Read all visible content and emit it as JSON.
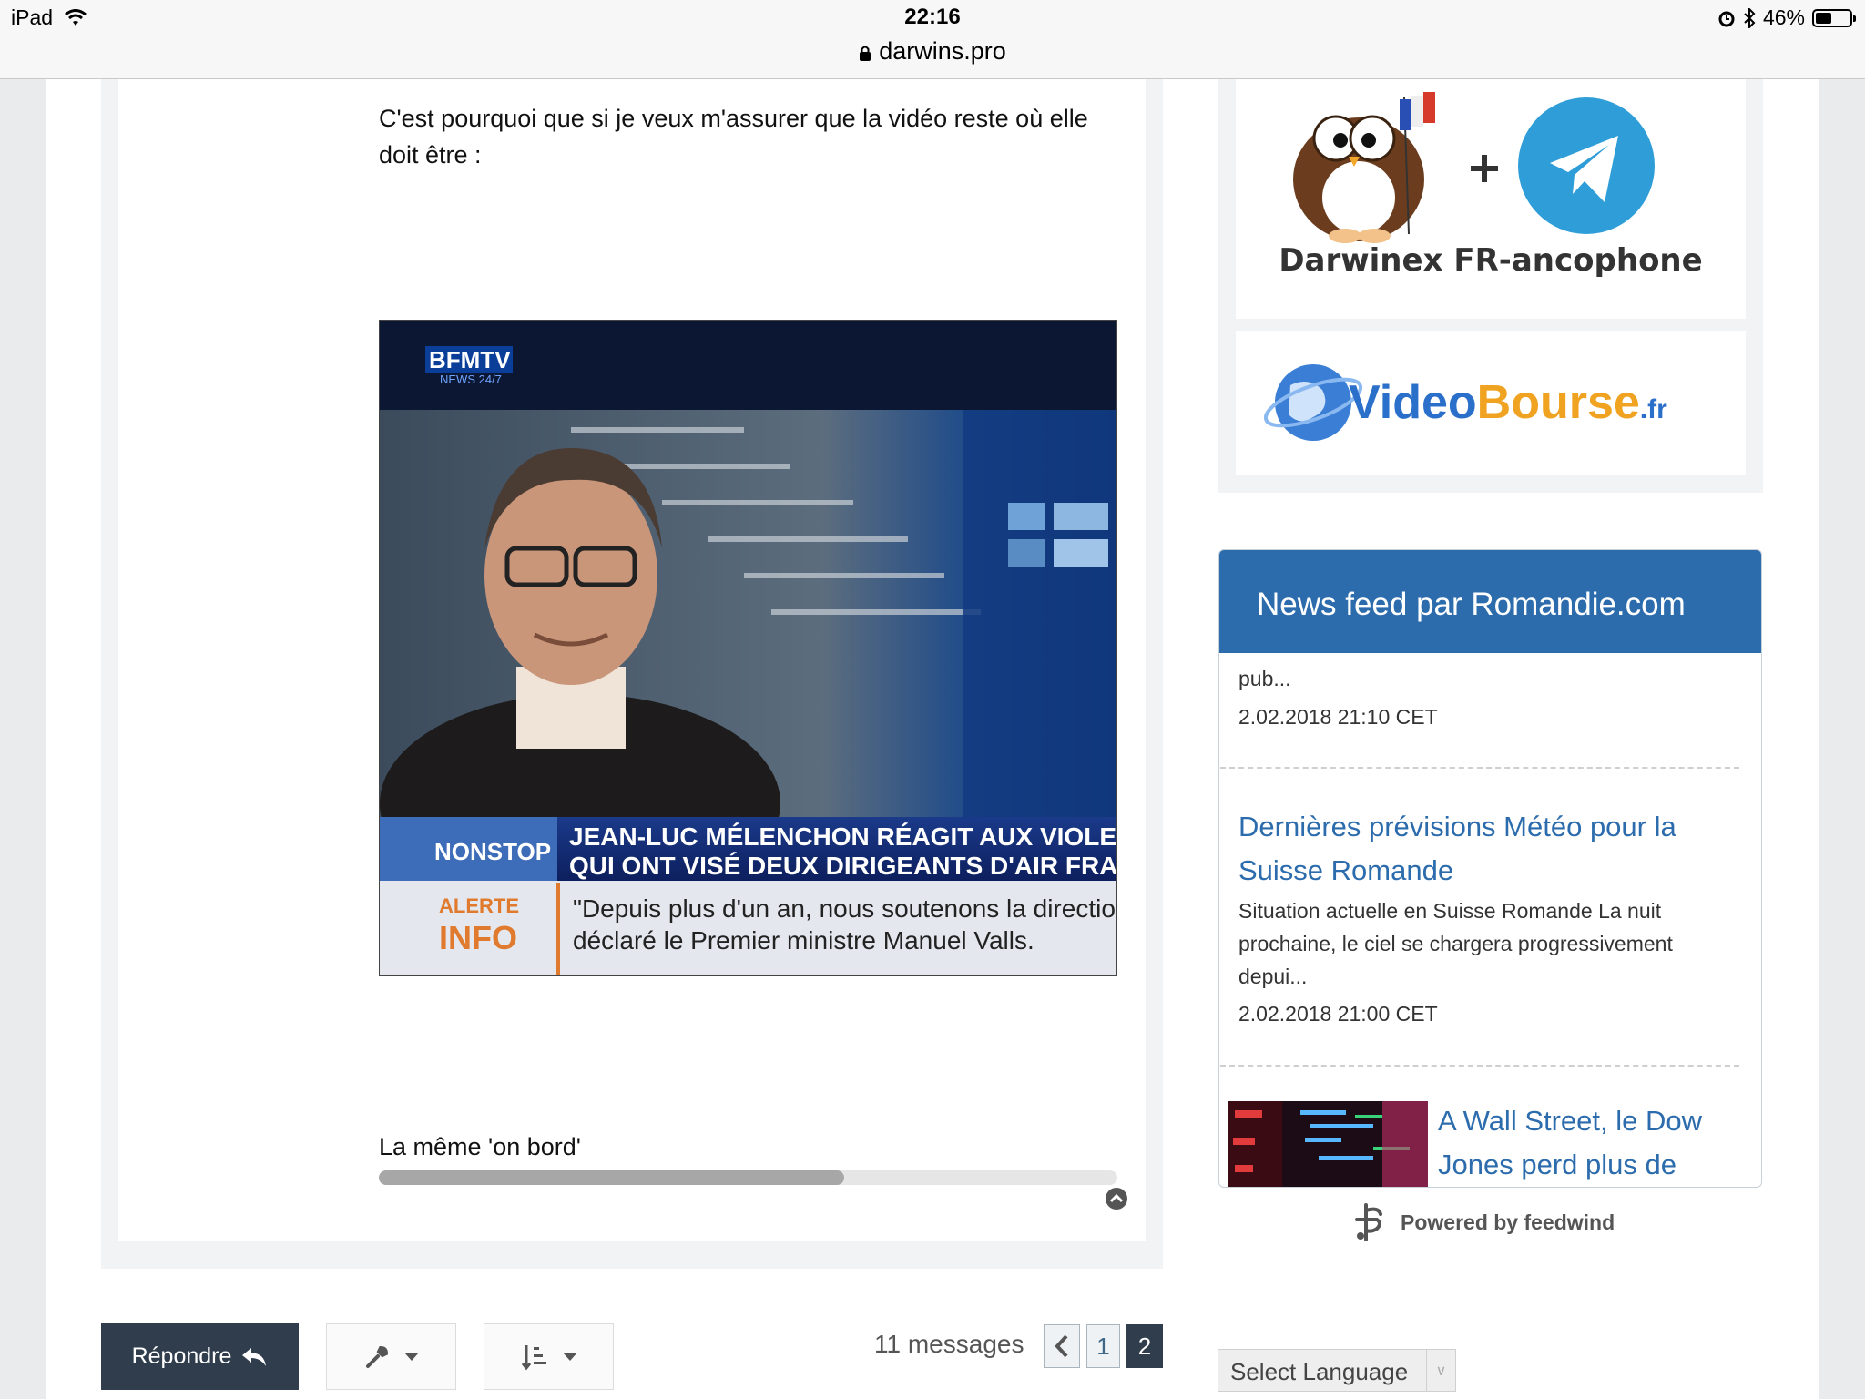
{
  "status_bar": {
    "device": "iPad",
    "time": "22:16",
    "url": "darwins.pro",
    "battery_text": "46%",
    "battery_level": 0.46
  },
  "post": {
    "text": "C'est pourquoi que si je veux m'assurer que la vidéo reste où elle doit être :",
    "video": {
      "channel_logo": "BFMTV",
      "channel_sub": "NEWS 24/7",
      "ticker_tag": "NONSTOP",
      "headline_line1": "JEAN-LUC MÉLENCHON RÉAGIT AUX VIOLE",
      "headline_line2": "QUI ONT VISÉ DEUX DIRIGEANTS D'AIR FRA",
      "alert_tag_1": "ALERTE",
      "alert_tag_2": "INFO",
      "quote_line1": "\"Depuis plus d'un an, nous soutenons la direction",
      "quote_line2": "déclaré le Premier ministre Manuel Valls."
    },
    "caption": "La même 'on bord'",
    "scroll_position": 0.63
  },
  "toolbar": {
    "reply_label": "Répondre",
    "message_count": "11 messages",
    "pages": [
      "1",
      "2"
    ],
    "current_page": "2"
  },
  "sidebar": {
    "telegram_banner_text": "Darwinex FR-ancophone",
    "videobourse_text_1": "Video",
    "videobourse_text_2": "Bourse",
    "videobourse_text_3": ".fr",
    "news_widget": {
      "title": "News feed par Romandie.com",
      "items": [
        {
          "snippet": "pub...",
          "date": "2.02.2018 21:10 CET"
        },
        {
          "title_line1": "Dernières prévisions Météo pour la",
          "title_line2": "Suisse Romande",
          "snippet_line1": "Situation actuelle en Suisse Romande La nuit",
          "snippet_line2": "prochaine, le ciel se chargera progressivement",
          "snippet_line3": "depui...",
          "date": "2.02.2018 21:00 CET"
        },
        {
          "title_line1": "A Wall Street, le Dow",
          "title_line2": "Jones perd plus de"
        }
      ],
      "powered_by": "Powered by feedwind"
    },
    "language_select": "Select Language"
  },
  "colors": {
    "accent": "#2c6cad",
    "dark_button": "#2f3d4c"
  }
}
